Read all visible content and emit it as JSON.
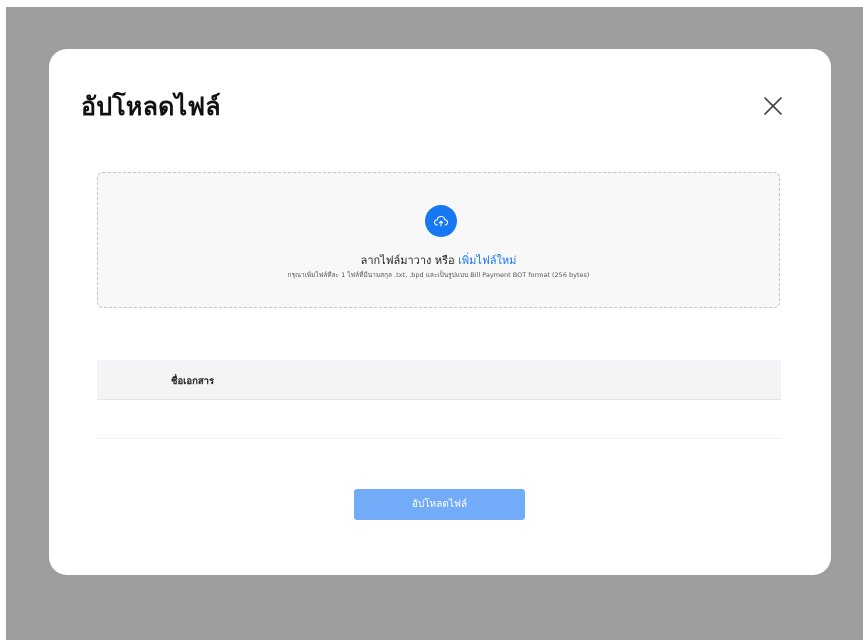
{
  "modal": {
    "title": "อัปโหลดไฟล์",
    "close_icon": "close-icon"
  },
  "dropzone": {
    "icon": "cloud-upload-icon",
    "prompt_text": "ลากไฟล์มาวาง หรือ ",
    "prompt_link": "เพิ่มไฟล์ใหม่",
    "hint": "กรุณาเพิ่มไฟล์ทีละ 1 ไฟล์ที่มีนามสกุล .txt, .bpd และเป็นรูปแบบ Bill Payment BOT format (256 bytes)"
  },
  "table": {
    "columns": [
      "ชื่อเอกสาร"
    ],
    "rows": []
  },
  "actions": {
    "submit_label": "อัปโหลดไฟล์"
  },
  "colors": {
    "overlay": "#9e9e9e",
    "accent": "#1877f2",
    "submit_disabled": "#72abf7",
    "table_header": "#f3f4f6"
  }
}
